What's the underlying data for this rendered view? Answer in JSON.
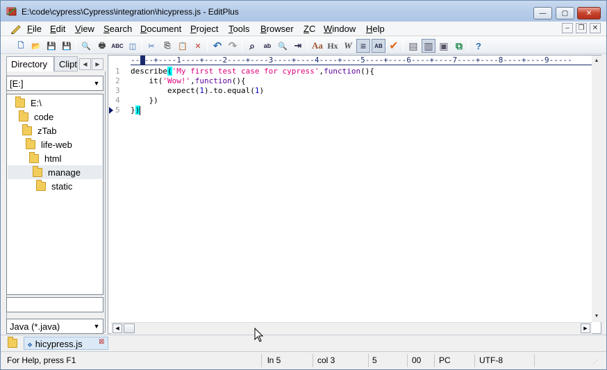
{
  "window": {
    "title": "E:\\code\\cypress\\Cypress\\integration\\hicypress.js - EditPlus",
    "min_glyph": "—",
    "max_glyph": "▢",
    "close_glyph": "✕"
  },
  "menu": {
    "items": [
      "File",
      "Edit",
      "View",
      "Search",
      "Document",
      "Project",
      "Tools",
      "Browser",
      "ZC",
      "Window",
      "Help"
    ],
    "mdi_min": "–",
    "mdi_restore": "❐",
    "mdi_close": "✕"
  },
  "toolbar": {
    "buttons": [
      {
        "name": "new-file-icon",
        "glyph": "🗋"
      },
      {
        "name": "open-folder-icon",
        "glyph": "📂"
      },
      {
        "name": "save-icon",
        "glyph": "💾"
      },
      {
        "name": "save-all-icon",
        "glyph": "💾"
      },
      {
        "name": "print-preview-icon",
        "glyph": "🔍"
      },
      {
        "name": "print-icon",
        "glyph": "🖶"
      },
      {
        "name": "spell-check-icon",
        "glyph": "ABC"
      },
      {
        "name": "browser-preview-icon",
        "glyph": "◫"
      },
      {
        "name": "cut-icon",
        "glyph": "✂"
      },
      {
        "name": "copy-icon",
        "glyph": "⎘"
      },
      {
        "name": "paste-icon",
        "glyph": "📋"
      },
      {
        "name": "delete-icon",
        "glyph": "✕"
      },
      {
        "name": "undo-icon",
        "glyph": "↶"
      },
      {
        "name": "redo-icon",
        "glyph": "↷"
      },
      {
        "name": "find-icon",
        "glyph": "⌕"
      },
      {
        "name": "replace-icon",
        "glyph": "ab"
      },
      {
        "name": "find-in-files-icon",
        "glyph": "🔍"
      },
      {
        "name": "goto-line-icon",
        "glyph": "⇥"
      },
      {
        "name": "font-icon",
        "glyph": "Aa"
      },
      {
        "name": "hex-view-icon",
        "glyph": "Hx"
      },
      {
        "name": "word-wrap-icon",
        "glyph": "W"
      },
      {
        "name": "line-numbers-icon",
        "glyph": "≡"
      },
      {
        "name": "column-select-icon",
        "glyph": "AB"
      },
      {
        "name": "check-icon",
        "glyph": "✔"
      },
      {
        "name": "directory-window-icon",
        "glyph": "▤"
      },
      {
        "name": "cliptext-window-icon",
        "glyph": "▥"
      },
      {
        "name": "output-window-icon",
        "glyph": "▣"
      },
      {
        "name": "tile-window-icon",
        "glyph": "⧉"
      },
      {
        "name": "context-help-icon",
        "glyph": "?"
      }
    ]
  },
  "left_pane": {
    "tab_directory": "Directory",
    "tab_cliptext": "Clipt",
    "nav_prev": "◀",
    "nav_next": "▶",
    "drive": "[E:]",
    "tree": [
      "E:\\",
      "code",
      "zTab",
      "life-web",
      "html",
      "manage",
      "static"
    ],
    "selected_index": 5,
    "filter_value": "",
    "file_type": "Java (*.java)",
    "dropdown_arrow": "▼"
  },
  "editor": {
    "ruler": "-- --+----1----+----2----+----3----+----4----+----5----+----6----+----7----+----8----+----9-----",
    "line_numbers": [
      "1",
      "2",
      "3",
      "4",
      "5"
    ],
    "lines": [
      {
        "parts": [
          {
            "t": "describe",
            "c": ""
          },
          {
            "t": "(",
            "c": "brace-hl"
          },
          {
            "t": "'My first test case for cypress'",
            "c": "str"
          },
          {
            "t": ",",
            "c": ""
          },
          {
            "t": "function",
            "c": "kw"
          },
          {
            "t": "(){",
            "c": ""
          }
        ]
      },
      {
        "parts": [
          {
            "t": "    it(",
            "c": ""
          },
          {
            "t": "'Wow!'",
            "c": "str"
          },
          {
            "t": ",",
            "c": ""
          },
          {
            "t": "function",
            "c": "kw"
          },
          {
            "t": "(){",
            "c": ""
          }
        ]
      },
      {
        "parts": [
          {
            "t": "        expect(",
            "c": ""
          },
          {
            "t": "1",
            "c": "num"
          },
          {
            "t": ").to.equal(",
            "c": ""
          },
          {
            "t": "1",
            "c": "num"
          },
          {
            "t": ")",
            "c": ""
          }
        ]
      },
      {
        "parts": [
          {
            "t": "    })",
            "c": ""
          }
        ]
      },
      {
        "parts": [
          {
            "t": "}",
            "c": ""
          },
          {
            "t": ")",
            "c": "brace-hl"
          }
        ]
      }
    ],
    "bookmark_line": 5,
    "scroll_up": "▲",
    "scroll_down": "▼",
    "scroll_left": "◀",
    "scroll_right": "▶"
  },
  "document_tabs": {
    "tabs": [
      {
        "label": "hicypress.js",
        "marker": "❖"
      }
    ],
    "close_glyph": "⊠"
  },
  "status": {
    "help": "For Help, press F1",
    "line": "ln 5",
    "col": "col 3",
    "lines": "5",
    "chars": "00",
    "line_ending": "PC",
    "encoding": "UTF-8"
  }
}
